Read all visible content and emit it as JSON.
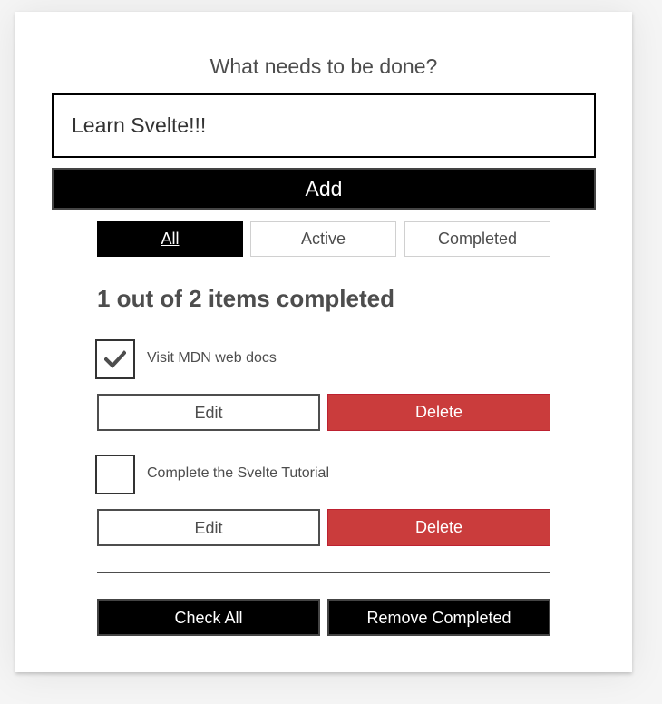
{
  "form": {
    "heading": "What needs to be done?",
    "input_value": "Learn Svelte!!!",
    "add_label": "Add"
  },
  "filters": [
    {
      "label": "All",
      "active": true
    },
    {
      "label": "Active",
      "active": false
    },
    {
      "label": "Completed",
      "active": false
    }
  ],
  "status": "1 out of 2 items completed",
  "todos": [
    {
      "label": "Visit MDN web docs",
      "completed": true,
      "edit_label": "Edit",
      "delete_label": "Delete"
    },
    {
      "label": "Complete the Svelte Tutorial",
      "completed": false,
      "edit_label": "Edit",
      "delete_label": "Delete"
    }
  ],
  "actions": {
    "check_all_label": "Check All",
    "remove_completed_label": "Remove Completed"
  },
  "icons": {
    "checkmark": "checkmark-icon"
  },
  "colors": {
    "delete": "#ca3c3c",
    "primary_dark": "#000000",
    "text": "#4d4d4d"
  }
}
